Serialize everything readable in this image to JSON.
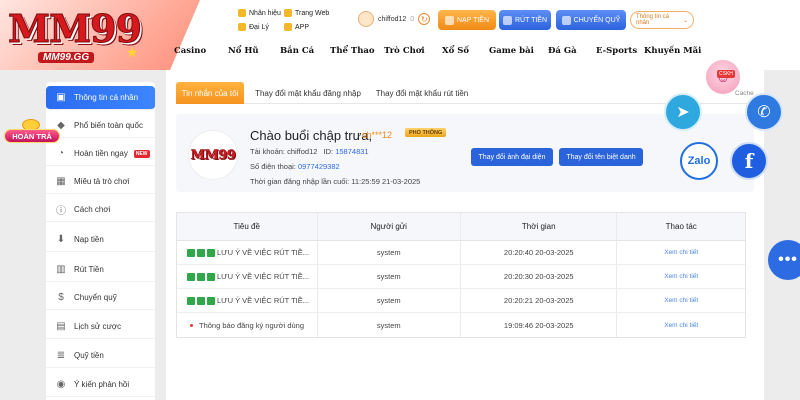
{
  "brand": {
    "logo_text": "MM99",
    "logo_sub": "MM99.GG"
  },
  "header": {
    "quick_links": [
      "Nhân hiệu",
      "Trang Web",
      "Đại Lý",
      "APP"
    ],
    "user": {
      "name": "chiffod12",
      "balance": "0"
    },
    "buttons": {
      "deposit": "NẠP TIỀN",
      "withdraw": "RÚT TIỀN",
      "transfer": "CHUYỂN QUỸ"
    },
    "account_select": "Thông tin cá nhân"
  },
  "nav": [
    "Casino",
    "Nổ Hũ",
    "Bắn Cá",
    "Thể Thao",
    "Trò Chơi",
    "Xổ Số",
    "Game bài",
    "Đá Gà",
    "E-Sports",
    "Khuyến Mãi"
  ],
  "promo": {
    "hoan_tra": "HOÀN TRẢ"
  },
  "sidebar": {
    "items": [
      {
        "label": "Thông tin cá nhân",
        "icon": "user-card-icon"
      },
      {
        "label": "Phổ biến toàn quốc",
        "icon": "diamond-icon"
      },
      {
        "label": "Hoàn tiền ngay",
        "icon": "refund-icon",
        "badge": "NEW"
      },
      {
        "label": "Miêu tả trò chơi",
        "icon": "gamepad-icon"
      },
      {
        "label": "Cách chơi",
        "icon": "info-icon"
      },
      {
        "label": "Nạp tiền",
        "icon": "deposit-icon"
      },
      {
        "label": "Rút Tiền",
        "icon": "withdraw-icon"
      },
      {
        "label": "Chuyển quỹ",
        "icon": "transfer-icon"
      },
      {
        "label": "Lịch sử cược",
        "icon": "history-icon"
      },
      {
        "label": "Quỹ tiền",
        "icon": "fund-icon"
      },
      {
        "label": "Ý kiến phản hồi",
        "icon": "feedback-icon"
      }
    ]
  },
  "tabs": [
    "Tin nhắn của tôi",
    "Thay đổi mật khẩu đăng nhập",
    "Thay đổi mật khẩu rút tiền"
  ],
  "profile": {
    "greeting": "Chào buổi chập trưa,",
    "masked_name": "ch***12",
    "vip_label": "PHỔ THÔNG",
    "account_label": "Tài khoản:",
    "account_value": "chiffod12",
    "id_label": "ID:",
    "id_value": "15874831",
    "phone_label": "Số điện thoại:",
    "phone_value": "0977429382",
    "last_login_label": "Thời gian đăng nhập lần cuối:",
    "last_login_value": "11:25:59 21-03-2025",
    "change_avatar": "Thay đổi ảnh đại diện",
    "change_nickname": "Thay đổi tên biệt danh"
  },
  "table": {
    "headers": [
      "Tiêu đề",
      "Người gửi",
      "Thời gian",
      "Thao tác"
    ],
    "rows": [
      {
        "title": "LƯU Ý VỀ VIỆC RÚT TIỀ...",
        "sender": "system",
        "time": "20:20:40 20-03-2025",
        "action": "Xem chi tiết"
      },
      {
        "title": "LƯU Ý VỀ VIỆC RÚT TIỀ...",
        "sender": "system",
        "time": "20:20:30 20-03-2025",
        "action": "Xem chi tiết"
      },
      {
        "title": "LƯU Ý VỀ VIỆC RÚT TIỀ...",
        "sender": "system",
        "time": "20:20:21 20-03-2025",
        "action": "Xem chi tiết"
      },
      {
        "title": "Thông báo đăng ký người dùng",
        "sender": "system",
        "time": "19:09:46 20-03-2025",
        "action": "Xem chi tiết"
      }
    ]
  },
  "contacts": {
    "cskh": "CSKH",
    "cskh_sub": "Cache",
    "zalo": "Zalo",
    "facebook": "f",
    "more": "•••"
  },
  "colors": {
    "primary": "#2a6bf0",
    "accent_orange": "#f6921e",
    "brand_red": "#d7191d"
  }
}
